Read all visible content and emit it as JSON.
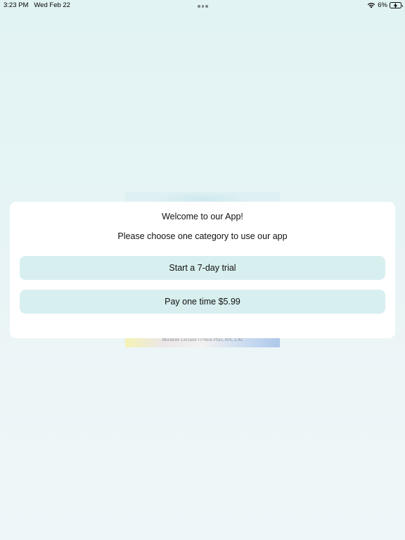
{
  "status_bar": {
    "time": "3:23 PM",
    "date": "Wed Feb 22",
    "battery_percent": "6%",
    "icons": [
      "wifi-icon",
      "battery-charging-icon"
    ]
  },
  "multitasking": {
    "icon": "more-dots-icon"
  },
  "background_poster": {
    "author": "Michelle Leclaire O'Neill PhD, RN, LAc"
  },
  "dialog": {
    "title": "Welcome to our App!",
    "subtitle": "Please choose one category to use our app",
    "options": [
      {
        "label": "Start a 7-day trial"
      },
      {
        "label": "Pay one time $5.99"
      }
    ]
  },
  "colors": {
    "background": "#e4f3f4",
    "dialog_background": "#ffffff",
    "button_background": "#d8eff0",
    "text": "#111111"
  }
}
